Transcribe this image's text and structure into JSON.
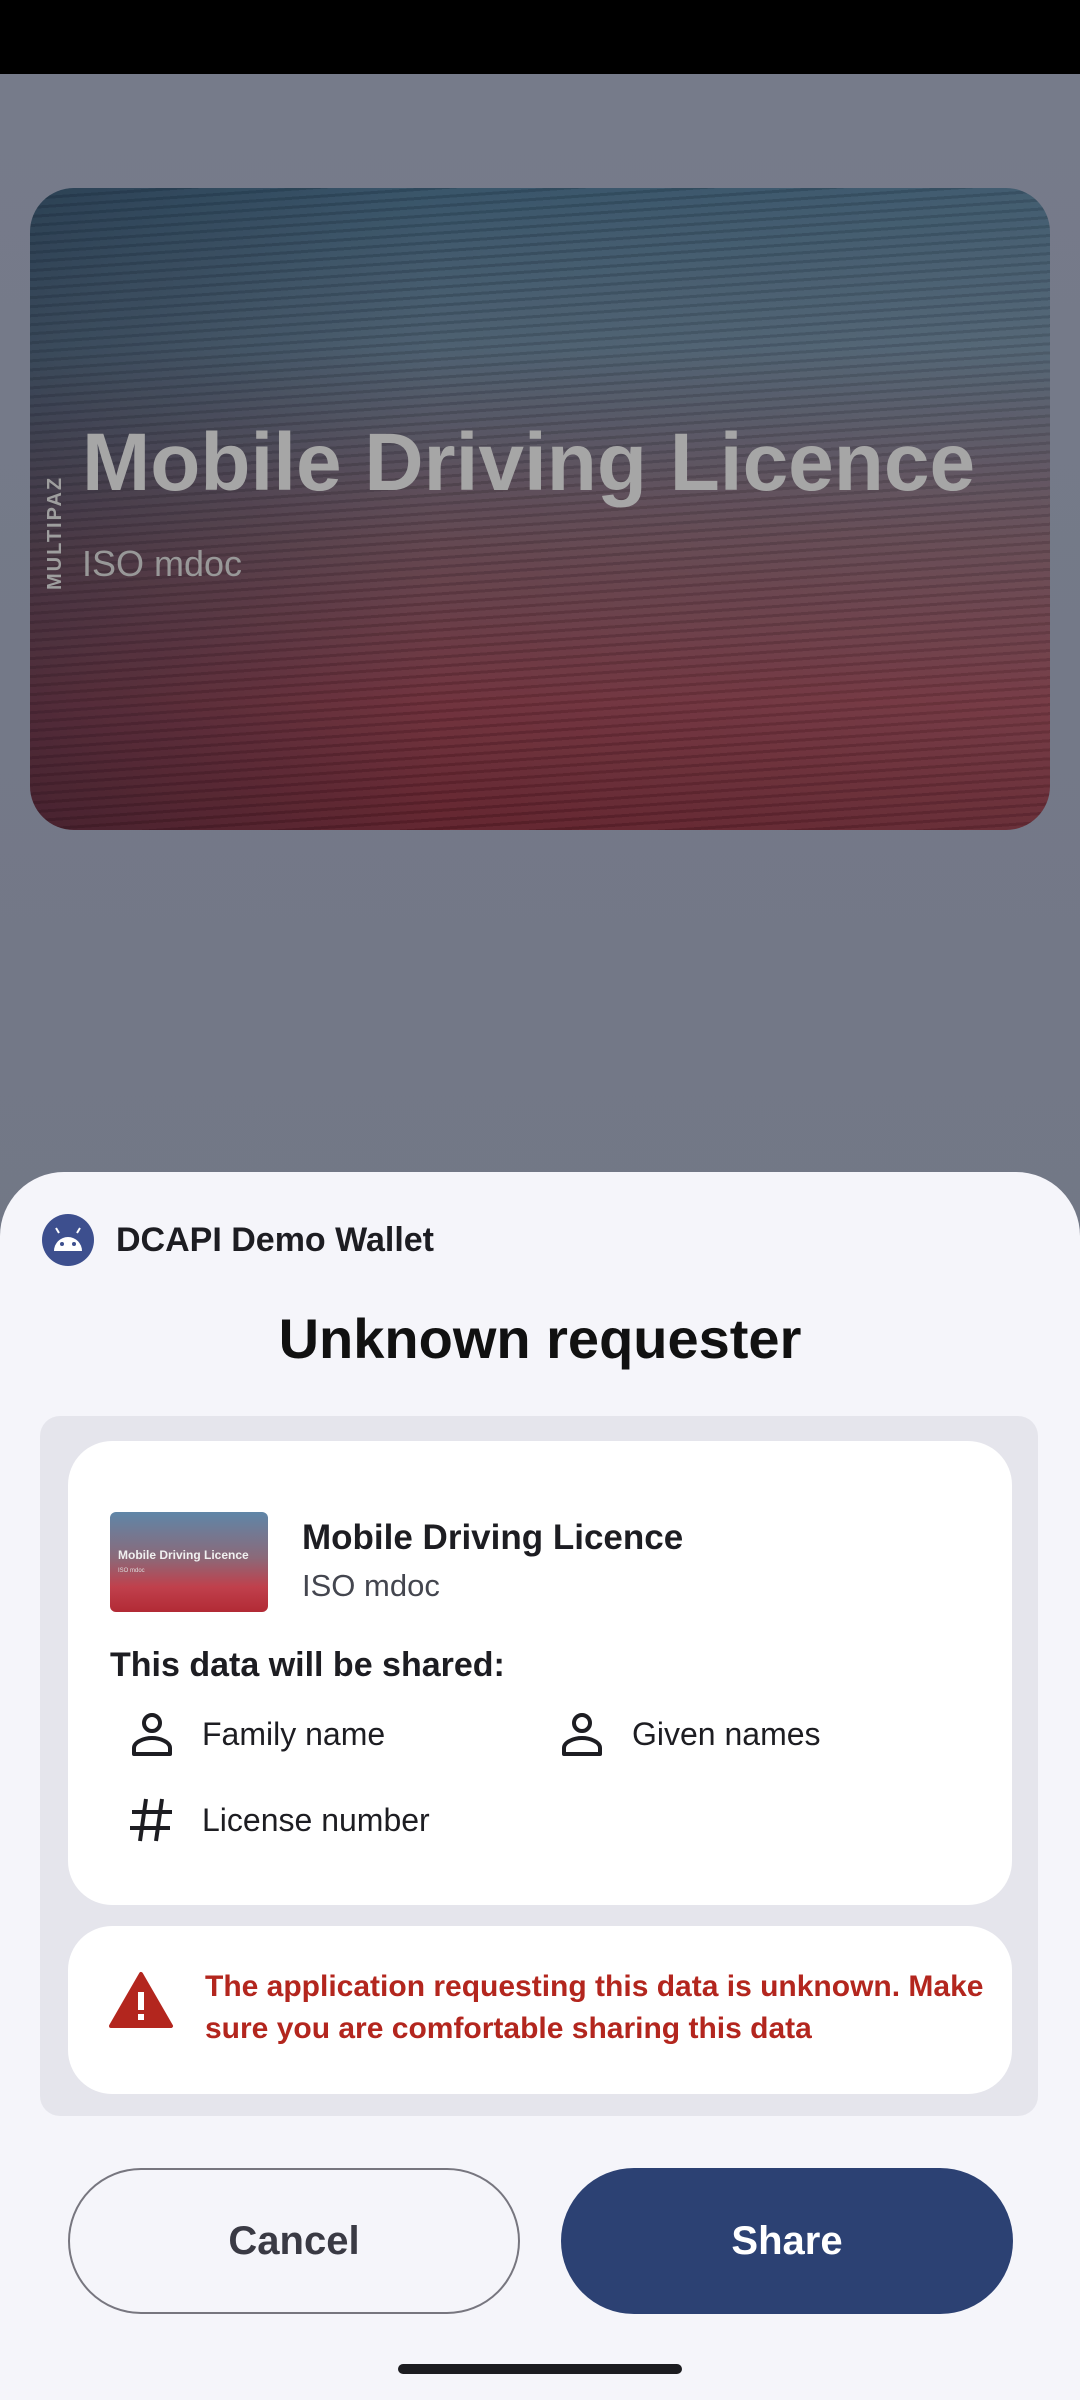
{
  "background_card": {
    "title": "Mobile Driving Licence",
    "subtitle": "ISO mdoc",
    "brand": "MULTIPAZ"
  },
  "sheet": {
    "app_name": "DCAPI Demo Wallet",
    "app_icon": "android-icon",
    "title": "Unknown requester",
    "document": {
      "thumbnail_title": "Mobile Driving Licence",
      "thumbnail_sub": "ISO mdoc",
      "title": "Mobile Driving Licence",
      "subtitle": "ISO mdoc"
    },
    "share_heading": "This data will be shared:",
    "fields": [
      {
        "label": "Family name",
        "icon": "person-icon"
      },
      {
        "label": "Given names",
        "icon": "person-icon"
      },
      {
        "label": "License number",
        "icon": "hash-icon"
      }
    ],
    "warning": {
      "icon": "warning-icon",
      "color": "#b3261e",
      "text": "The application requesting this data is unknown. Make sure you are comfortable sharing this data"
    },
    "buttons": {
      "cancel": "Cancel",
      "share": "Share"
    },
    "accent_color": "#2c4173"
  }
}
